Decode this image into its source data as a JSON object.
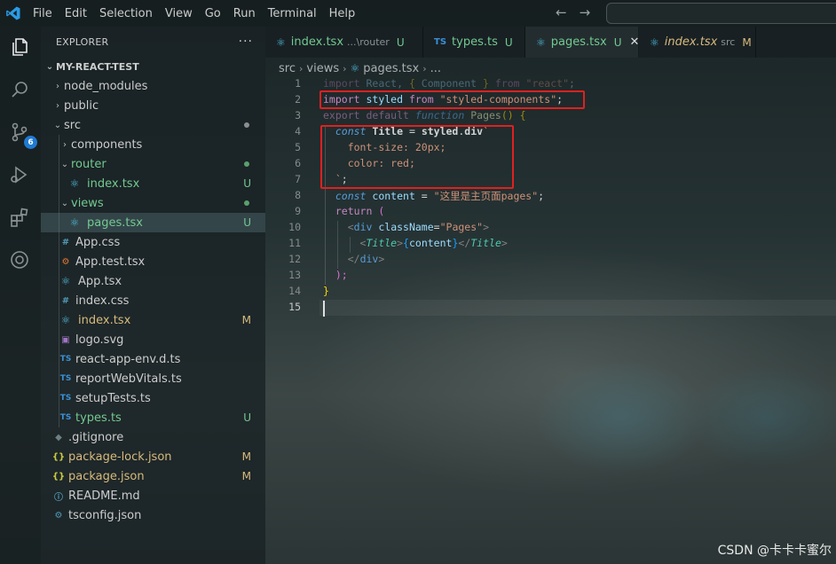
{
  "menu": [
    "File",
    "Edit",
    "Selection",
    "View",
    "Go",
    "Run",
    "Terminal",
    "Help"
  ],
  "activity": {
    "source_control_badge": "6"
  },
  "explorer": {
    "title": "EXPLORER",
    "more": "···",
    "root": "MY-REACT-TEST",
    "items": [
      {
        "label": "node_modules",
        "status": ""
      },
      {
        "label": "public",
        "status": ""
      },
      {
        "label": "src",
        "status": ""
      },
      {
        "label": "components",
        "status": ""
      },
      {
        "label": "router",
        "status": ""
      },
      {
        "label": "index.tsx",
        "status": "U"
      },
      {
        "label": "views",
        "status": ""
      },
      {
        "label": "pages.tsx",
        "status": "U"
      },
      {
        "label": "App.css",
        "status": ""
      },
      {
        "label": "App.test.tsx",
        "status": ""
      },
      {
        "label": "App.tsx",
        "status": ""
      },
      {
        "label": "index.css",
        "status": ""
      },
      {
        "label": "index.tsx",
        "status": "M"
      },
      {
        "label": "logo.svg",
        "status": ""
      },
      {
        "label": "react-app-env.d.ts",
        "status": ""
      },
      {
        "label": "reportWebVitals.ts",
        "status": ""
      },
      {
        "label": "setupTests.ts",
        "status": ""
      },
      {
        "label": "types.ts",
        "status": "U"
      },
      {
        "label": ".gitignore",
        "status": ""
      },
      {
        "label": "package-lock.json",
        "status": "M"
      },
      {
        "label": "package.json",
        "status": "M"
      },
      {
        "label": "README.md",
        "status": ""
      },
      {
        "label": "tsconfig.json",
        "status": ""
      }
    ]
  },
  "tabs": [
    {
      "label": "index.tsx",
      "sub": "...\\router",
      "status": "U"
    },
    {
      "label": "types.ts",
      "sub": "",
      "status": "U"
    },
    {
      "label": "pages.tsx",
      "sub": "",
      "status": "U",
      "close": "✕"
    },
    {
      "label": "index.tsx",
      "sub": "src",
      "status": "M"
    }
  ],
  "breadcrumb": [
    "src",
    "views",
    "pages.tsx",
    "..."
  ],
  "line_numbers": [
    "1",
    "2",
    "3",
    "4",
    "5",
    "6",
    "7",
    "8",
    "9",
    "10",
    "11",
    "12",
    "13",
    "14",
    "15"
  ],
  "code": {
    "l1": [
      "import",
      " React, ",
      "{",
      " Component ",
      "}",
      " from ",
      "\"react\"",
      ";"
    ],
    "l2": [
      "import",
      " styled ",
      "from",
      " ",
      "\"styled-components\"",
      ";"
    ],
    "l3": [
      "export",
      " ",
      "default",
      " ",
      "function",
      " ",
      "Pages",
      "()",
      " {"
    ],
    "l4": [
      "const",
      " Title ",
      "=",
      " styled",
      ".",
      "div",
      "`"
    ],
    "l5": "font-size: 20px;",
    "l6": "color: red;",
    "l7": [
      "`",
      ";"
    ],
    "l8": [
      "const",
      " content ",
      "=",
      " ",
      "\"这里是主页面pages\"",
      ";"
    ],
    "l9": [
      "return",
      " ("
    ],
    "l10": [
      "<",
      "div",
      " className",
      "=",
      "\"Pages\"",
      ">"
    ],
    "l11": [
      "<",
      "Title",
      ">",
      "{",
      "content",
      "}",
      "</",
      "Title",
      ">"
    ],
    "l12": [
      "</",
      "div",
      ">"
    ],
    "l13": [
      ");"
    ],
    "l14": "}"
  },
  "watermark": "CSDN @卡卡卡蜜尔",
  "colors": {
    "accent": "#1f7ad1",
    "annotation": "#e02020",
    "untracked": "#73c991",
    "modified": "#d7ba7d"
  }
}
